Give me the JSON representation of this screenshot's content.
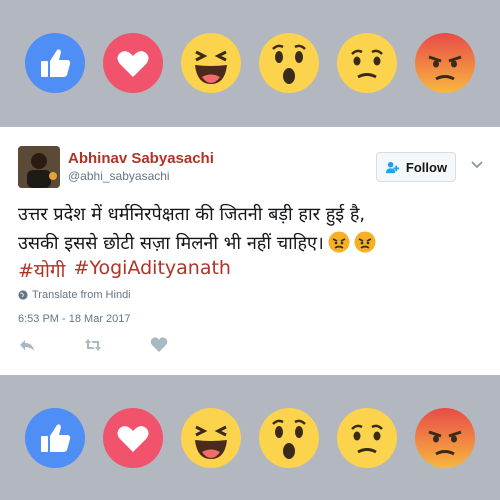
{
  "reactions": [
    "like-icon",
    "love-icon",
    "haha-icon",
    "wow-icon",
    "sad-icon",
    "angry-icon"
  ],
  "colors": {
    "like": "#4e8ef5",
    "love": "#f0536b",
    "emoji_yellow": "#fcd34d",
    "angry_top": "#e84b47",
    "link": "#b33226"
  },
  "tweet": {
    "author_name": "Abhinav Sabyasachi",
    "author_handle": "@abhi_sabyasachi",
    "follow_label": "Follow",
    "line1": "उत्तर प्रदेश में धर्मनिरपेक्षता की जितनी बड़ी हार हुई है,",
    "line2": "उसकी इससे छोटी सज़ा मिलनी भी नहीं चाहिए।",
    "hashtag1": "#योगी",
    "hashtag2": "#YogiAdityanath",
    "translate_label": "Translate from Hindi",
    "timestamp": "6:53 PM - 18 Mar 2017"
  }
}
